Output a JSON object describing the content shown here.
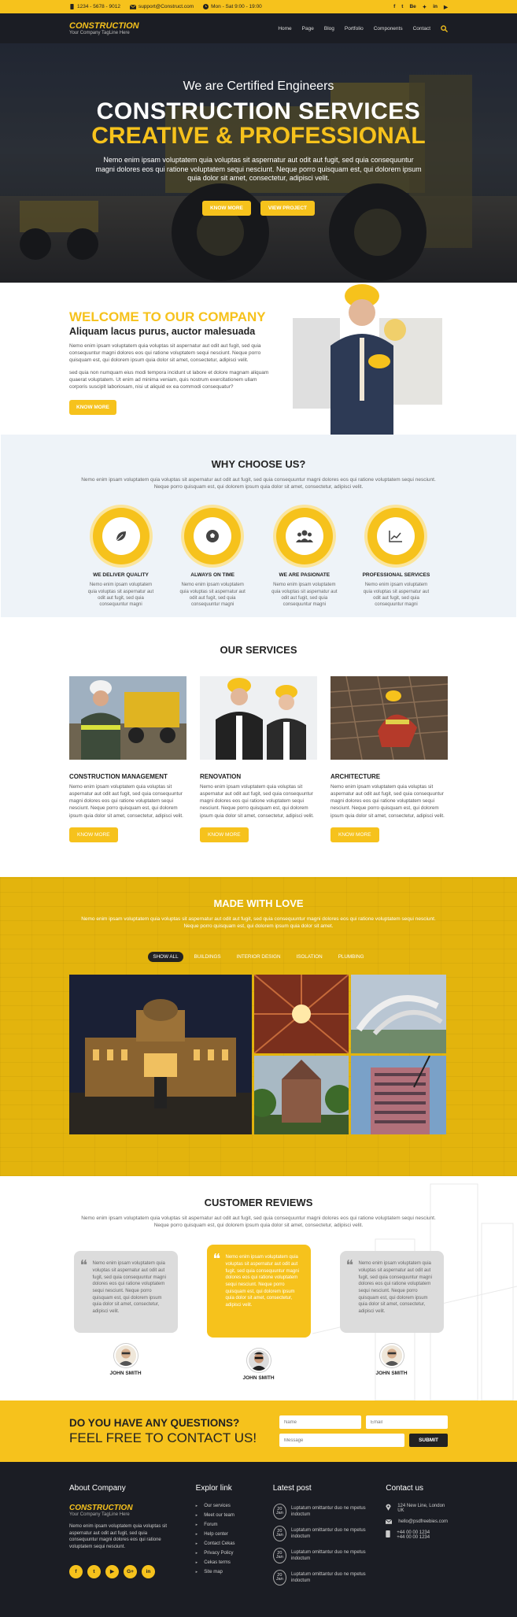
{
  "topbar": {
    "phone": "1234 - 5678 - 9012",
    "email": "support@Construct.com",
    "hours": "Mon - Sat 9:00 - 19:00",
    "social": [
      "f",
      "t",
      "Be",
      "✦",
      "in",
      "▶"
    ]
  },
  "nav": {
    "brand": "CONSTRUCTION",
    "tagline": "Your Company TagLine Here",
    "menu": [
      "Home",
      "Page",
      "Blog",
      "Portfolio",
      "Components",
      "Contact"
    ]
  },
  "hero": {
    "subtitle": "We are Certified Engineers",
    "title1": "CONSTRUCTION SERVICES",
    "title2": "CREATIVE & PROFESSIONAL",
    "desc": "Nemo enim ipsam voluptatem quia voluptas sit aspernatur aut odit aut fugit, sed quia consequuntur magni dolores eos qui ratione voluptatem sequi nesciunt. Neque porro quisquam est, qui dolorem ipsum quia dolor sit amet, consectetur, adipisci velit.",
    "btn1": "KNOW MORE",
    "btn2": "VIEW PROJECT"
  },
  "welcome": {
    "title": "WELCOME TO OUR COMPANY",
    "subtitle": "Aliquam lacus purus, auctor malesuada",
    "p1": "Nemo enim ipsam voluptatem quia voluptas sit aspernatur aut odit aut fugit, sed quia consequuntur magni dolores eos qui ratione voluptatem sequi nesciunt. Neque porro quisquam est, qui dolorem ipsum quia dolor sit amet, consectetur, adipisci velit.",
    "p2": "sed quia non numquam eius modi tempora incidunt ut labore et dolore magnam aliquam quaerat voluptatem. Ut enim ad minima veniam, quis nostrum exercitationem ullam corporis suscipit laboriosam, nisi ut aliquid ex ea commodi consequatur?",
    "btn": "KNOW MORE"
  },
  "why": {
    "title": "WHY CHOOSE US?",
    "desc": "Nemo enim ipsam voluptatem quia voluptas sit aspernatur aut odit aut fugit, sed quia consequuntur magni dolores eos qui ratione voluptatem sequi nesciunt. Neque porro quisquam est, qui dolorem ipsum quia dolor sit amet, consectetur, adipisci velit.",
    "features": [
      {
        "title": "WE DELIVER QUALITY",
        "text": "Nemo enim ipsam voluptatem quia voluptas sit aspernatur aut odit aut fugit, sed quia consequuntur magni",
        "icon": "leaf-icon"
      },
      {
        "title": "ALWAYS ON TIME",
        "text": "Nemo enim ipsam voluptatem quia voluptas sit aspernatur aut odit aut fugit, sed quia consequuntur magni",
        "icon": "football-icon"
      },
      {
        "title": "WE ARE PASIONATE",
        "text": "Nemo enim ipsam voluptatem quia voluptas sit aspernatur aut odit aut fugit, sed quia consequuntur magni",
        "icon": "team-icon"
      },
      {
        "title": "PROFESSIONAL SERVICES",
        "text": "Nemo enim ipsam voluptatem quia voluptas sit aspernatur aut odit aut fugit, sed quia consequuntur magni",
        "icon": "chart-icon"
      }
    ]
  },
  "services": {
    "title": "OUR SERVICES",
    "items": [
      {
        "title": "CONSTRUCTION MANAGEMENT",
        "text": "Nemo enim ipsam voluptatem quia voluptas sit aspernatur aut odit aut fugit, sed quia consequuntur magni dolores eos qui ratione voluptatem sequi nesciunt. Neque porro quisquam est, qui dolorem ipsum quia dolor sit amet, consectetur, adipisci velit.",
        "btn": "KNOW MORE"
      },
      {
        "title": "RENOVATION",
        "text": "Nemo enim ipsam voluptatem quia voluptas sit aspernatur aut odit aut fugit, sed quia consequuntur magni dolores eos qui ratione voluptatem sequi nesciunt. Neque porro quisquam est, qui dolorem ipsum quia dolor sit amet, consectetur, adipisci velit.",
        "btn": "KNOW MORE"
      },
      {
        "title": "ARCHITECTURE",
        "text": "Nemo enim ipsam voluptatem quia voluptas sit aspernatur aut odit aut fugit, sed quia consequuntur magni dolores eos qui ratione voluptatem sequi nesciunt. Neque porro quisquam est, qui dolorem ipsum quia dolor sit amet, consectetur, adipisci velit.",
        "btn": "KNOW MORE"
      }
    ]
  },
  "made": {
    "title": "MADE WITH LOVE",
    "desc": "Nemo enim ipsam voluptatem quia voluptas sit aspernatur aut odit aut fugit, sed quia consequuntur magni dolores eos qui ratione voluptatem sequi nesciunt. Neque porro quisquam est, qui dolorem ipsum quia dolor sit amet.",
    "filters": [
      "SHOW ALL",
      "BUILDINGS",
      "INTERIOR DESIGN",
      "ISOLATION",
      "PLUMBING"
    ]
  },
  "reviews": {
    "title": "CUSTOMER REVIEWS",
    "desc": "Nemo enim ipsam voluptatem quia voluptas sit aspernatur aut odit aut fugit, sed quia consequuntur magni dolores eos qui ratione voluptatem sequi nesciunt. Neque porro quisquam est, qui dolorem ipsum quia dolor sit amet, consectetur, adipisci velit.",
    "items": [
      {
        "text": "Nemo enim ipsam voluptatem quia voluptas sit aspernatur aut odit aut fugit, sed quia consequuntur magni dolores eos qui ratione voluptatem sequi nesciunt. Neque porro quisquam est, qui dolorem ipsum quia dolor sit amet, consectetur, adipisci velit.",
        "name": "JOHN SMITH"
      },
      {
        "text": "Nemo enim ipsam voluptatem quia voluptas sit aspernatur aut odit aut fugit, sed quia consequuntur magni dolores eos qui ratione voluptatem sequi nesciunt. Neque porro quisquam est, qui dolorem ipsum quia dolor sit amet, consectetur, adipisci velit.",
        "name": "JOHN SMITH"
      },
      {
        "text": "Nemo enim ipsam voluptatem quia voluptas sit aspernatur aut odit aut fugit, sed quia consequuntur magni dolores eos qui ratione voluptatem sequi nesciunt. Neque porro quisquam est, qui dolorem ipsum quia dolor sit amet, consectetur, adipisci velit.",
        "name": "JOHN SMITH"
      }
    ]
  },
  "contact": {
    "line1": "DO YOU HAVE ANY QUESTIONS?",
    "line2": "FEEL FREE TO CONTACT US!",
    "name_ph": "Name",
    "email_ph": "Email",
    "message_ph": "Message",
    "submit": "SUBMIT"
  },
  "footer": {
    "about_title": "About Company",
    "brand": "CONSTRUCTION",
    "tagline": "Your Company TagLine Here",
    "about_text": "Nemo enim ipsam voluptatem quia voluptas sit aspernatur aut odit aut fugit, sed quia consequuntur magni dolores eos qui ratione voluptatem sequi nesciunt.",
    "socials": [
      "f",
      "t",
      "▶",
      "G+",
      "in"
    ],
    "links_title": "Explor link",
    "links": [
      "Our services",
      "Meet our team",
      "Forum",
      "Help center",
      "Contact Cekas",
      "Privacy Policy",
      "Cekas terms",
      "Site map"
    ],
    "posts_title": "Latest post",
    "posts": [
      {
        "day": "20",
        "month": "Jan",
        "text": "Luptatum omittantur duo ne mpetus indoctum"
      },
      {
        "day": "20",
        "month": "Jan",
        "text": "Luptatum omittantur duo ne mpetus indoctum"
      },
      {
        "day": "20",
        "month": "Jan",
        "text": "Luptatum omittantur duo ne mpetus indoctum"
      },
      {
        "day": "20",
        "month": "Jan",
        "text": "Luptatum omittantur duo ne mpetus indoctum"
      }
    ],
    "contact_title": "Contact us",
    "address": "124 New Line, London UK",
    "email": "hello@psdfreebies.com",
    "phone1": "+44 00 00 1234",
    "phone2": "+44 00 00 1234"
  },
  "colors": {
    "accent": "#f6c21c",
    "dark": "#1b1d24"
  }
}
